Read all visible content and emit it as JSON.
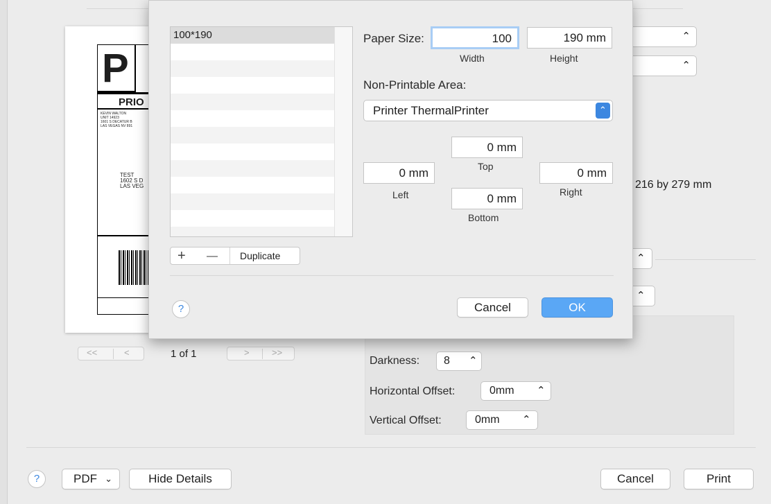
{
  "preview": {
    "label_big_letter": "P",
    "label_priority": "PRIO",
    "sender_lines": [
      "KEVIN WALTON",
      "UNIT 14923",
      "1601 S DECATUR B",
      "LAS VEGAS NV 891"
    ],
    "recipient_lines": [
      "TEST",
      "1602 S D",
      "LAS VEG"
    ],
    "page_indicator": "1 of 1",
    "nav_first": "<<",
    "nav_prev": "<",
    "nav_next": ">",
    "nav_last": ">>"
  },
  "right_panel": {
    "paper_dims_text": "216 by 279 mm",
    "darkness_label": "Darkness:",
    "darkness_value": "8",
    "horizontal_offset_label": "Horizontal Offset:",
    "horizontal_offset_value": "0mm",
    "vertical_offset_label": "Vertical Offset:",
    "vertical_offset_value": "0mm"
  },
  "sheet": {
    "list_items": [
      "100*190"
    ],
    "add_label": "+",
    "remove_label": "—",
    "duplicate_label": "Duplicate",
    "paper_size_label": "Paper Size:",
    "width_value": "100",
    "height_value": "190 mm",
    "width_label": "Width",
    "height_label": "Height",
    "non_printable_label": "Non-Printable Area:",
    "printer_select_value": "Printer ThermalPrinter",
    "top_value": "0 mm",
    "top_label": "Top",
    "left_value": "0 mm",
    "left_label": "Left",
    "right_value": "0 mm",
    "right_label": "Right",
    "bottom_value": "0 mm",
    "bottom_label": "Bottom",
    "help_label": "?",
    "cancel_label": "Cancel",
    "ok_label": "OK"
  },
  "bottom_bar": {
    "help_label": "?",
    "pdf_label": "PDF",
    "hide_details_label": "Hide Details",
    "cancel_label": "Cancel",
    "print_label": "Print"
  },
  "colors": {
    "accent": "#5aa7f5",
    "sheet_bg": "#ececec",
    "field_focus": "#a8cdf5"
  }
}
